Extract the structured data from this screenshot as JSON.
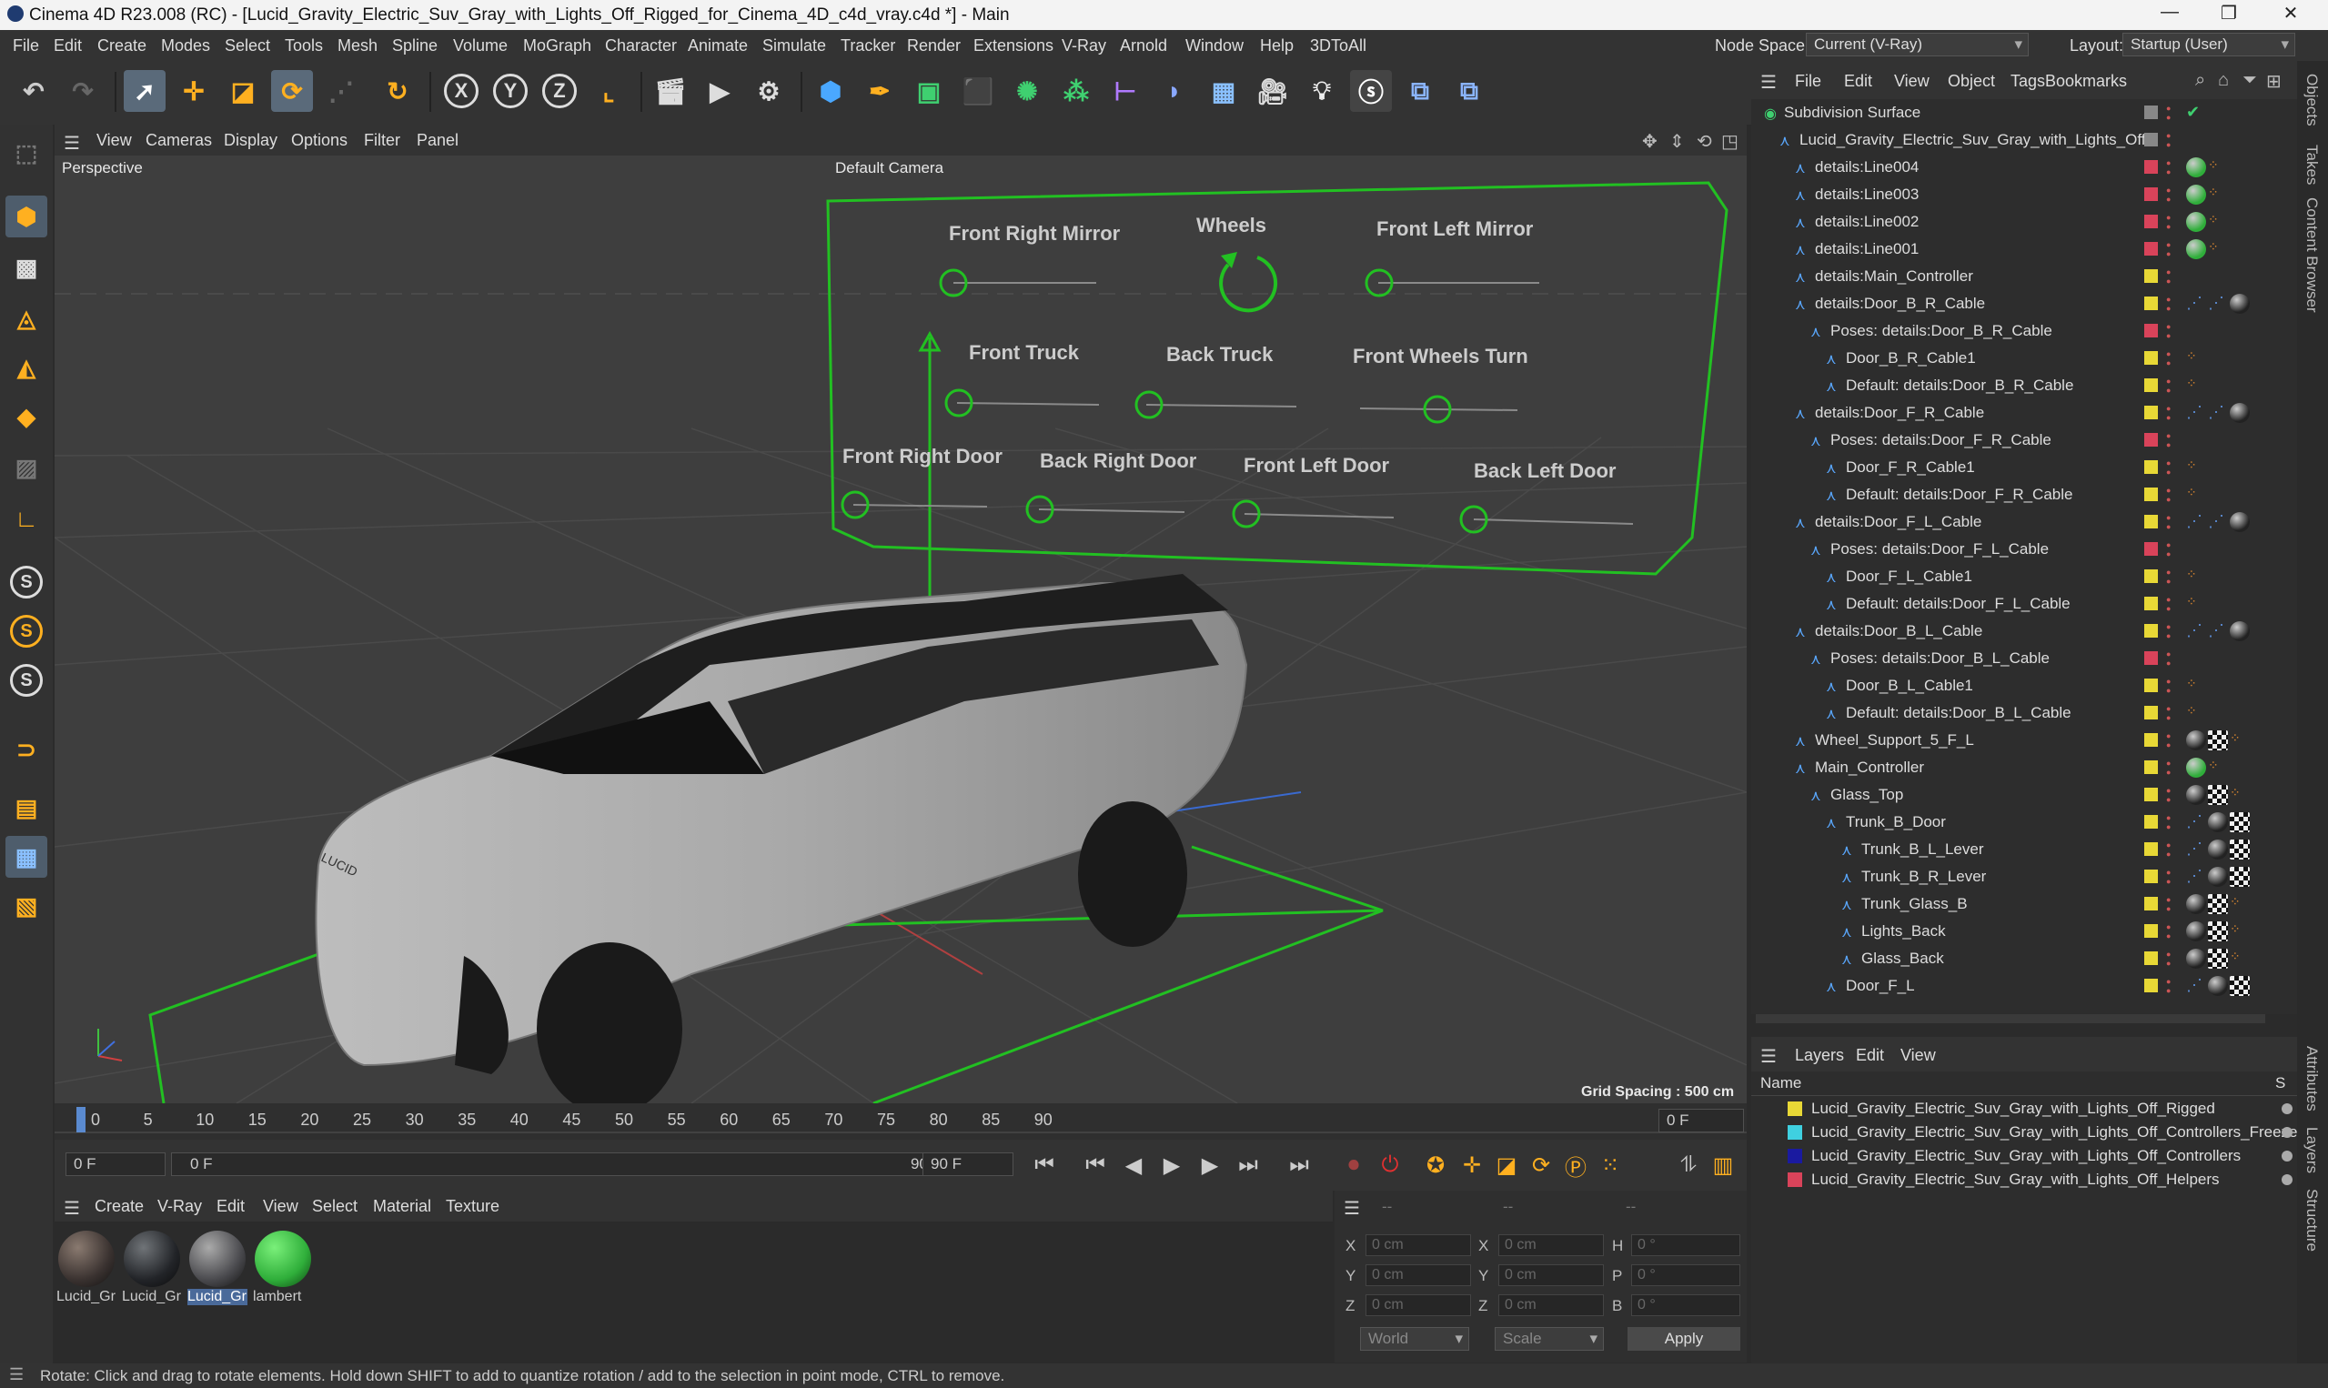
{
  "window": {
    "title": "Cinema 4D R23.008 (RC) - [Lucid_Gravity_Electric_Suv_Gray_with_Lights_Off_Rigged_for_Cinema_4D_c4d_vray.c4d *] - Main",
    "minimize": "—",
    "maximize": "❐",
    "close": "✕"
  },
  "menubar": {
    "items": [
      "File",
      "Edit",
      "Create",
      "Modes",
      "Select",
      "Tools",
      "Mesh",
      "Spline",
      "Volume",
      "MoGraph",
      "Character",
      "Animate",
      "Simulate",
      "Tracker",
      "Render",
      "Extensions",
      "V-Ray",
      "Arnold",
      "Window",
      "Help",
      "3DToAll"
    ],
    "node_space_label": "Node Space:",
    "node_space_value": "Current (V-Ray)",
    "layout_label": "Layout:",
    "layout_value": "Startup (User)"
  },
  "toolbar": {
    "axis_x": "X",
    "axis_y": "Y",
    "axis_z": "Z"
  },
  "lefttools": {
    "s1": "S",
    "s2": "S",
    "s3": "S"
  },
  "viewport": {
    "menu": [
      "View",
      "Cameras",
      "Display",
      "Options",
      "Filter",
      "Panel"
    ],
    "projection": "Perspective",
    "camera": "Default Camera",
    "grid_spacing": "Grid Spacing : 500 cm",
    "car_badge": "LUCID",
    "controls": {
      "front_right_mirror": "Front Right Mirror",
      "wheels": "Wheels",
      "front_left_mirror": "Front Left Mirror",
      "front_truck": "Front Truck",
      "back_truck": "Back Truck",
      "front_wheels_turn": "Front Wheels Turn",
      "front_right_door": "Front Right Door",
      "back_right_door": "Back Right Door",
      "front_left_door": "Front Left Door",
      "back_left_door": "Back Left Door"
    }
  },
  "timeline": {
    "ticks": [
      "0",
      "5",
      "10",
      "15",
      "20",
      "25",
      "30",
      "35",
      "40",
      "45",
      "50",
      "55",
      "60",
      "65",
      "70",
      "75",
      "80",
      "85",
      "90"
    ],
    "current_frame": "0 F",
    "start_frame": "0 F",
    "range_start": "0 F",
    "range_end": "90 F",
    "end_frame": "90 F"
  },
  "materials": {
    "menu": [
      "Create",
      "V-Ray",
      "Edit",
      "View",
      "Select",
      "Material",
      "Texture"
    ],
    "items": [
      {
        "label": "Lucid_Gr",
        "color": "#3a3230"
      },
      {
        "label": "Lucid_Gr",
        "color": "#222428"
      },
      {
        "label": "Lucid_Gr",
        "color": "#4a4a4e"
      },
      {
        "label": "lambert",
        "color": "#2fae3a"
      }
    ]
  },
  "coords": {
    "header_a": "--",
    "header_b": "--",
    "header_c": "--",
    "x": "X",
    "y": "Y",
    "z": "Z",
    "x2": "X",
    "y2": "Y",
    "z2": "Z",
    "h": "H",
    "p": "P",
    "b": "B",
    "zero_cm": "0 cm",
    "zero_deg": "0 °",
    "world": "World",
    "scale": "Scale",
    "apply": "Apply"
  },
  "status": "Rotate: Click and drag to rotate elements. Hold down SHIFT to add to quantize rotation / add to the selection in point mode, CTRL to remove.",
  "object_manager": {
    "menu": [
      "File",
      "Edit",
      "View",
      "Object",
      "Tags",
      "Bookmarks"
    ],
    "rows": [
      {
        "name": "Subdivision Surface",
        "indent": 0,
        "layer": "#888",
        "tags": [
          "check"
        ]
      },
      {
        "name": "Lucid_Gravity_Electric_Suv_Gray_with_Lights_Off",
        "indent": 1,
        "layer": "#888",
        "tags": []
      },
      {
        "name": "details:Line004",
        "indent": 2,
        "layer": "#d9435a",
        "tags": [
          "green",
          "orange"
        ]
      },
      {
        "name": "details:Line003",
        "indent": 2,
        "layer": "#d9435a",
        "tags": [
          "green",
          "orange"
        ]
      },
      {
        "name": "details:Line002",
        "indent": 2,
        "layer": "#d9435a",
        "tags": [
          "green",
          "orange"
        ]
      },
      {
        "name": "details:Line001",
        "indent": 2,
        "layer": "#d9435a",
        "tags": [
          "green",
          "orange"
        ]
      },
      {
        "name": "details:Main_Controller",
        "indent": 2,
        "layer": "#e8d836",
        "tags": []
      },
      {
        "name": "details:Door_B_R_Cable",
        "indent": 2,
        "layer": "#e8d836",
        "tags": [
          "blue",
          "blue",
          "dark"
        ]
      },
      {
        "name": "Poses: details:Door_B_R_Cable",
        "indent": 3,
        "layer": "#d9435a",
        "tags": []
      },
      {
        "name": "Door_B_R_Cable1",
        "indent": 4,
        "layer": "#e8d836",
        "tags": [
          "orange"
        ]
      },
      {
        "name": "Default: details:Door_B_R_Cable",
        "indent": 4,
        "layer": "#e8d836",
        "tags": [
          "orange"
        ]
      },
      {
        "name": "details:Door_F_R_Cable",
        "indent": 2,
        "layer": "#e8d836",
        "tags": [
          "blue",
          "blue",
          "dark"
        ]
      },
      {
        "name": "Poses: details:Door_F_R_Cable",
        "indent": 3,
        "layer": "#d9435a",
        "tags": []
      },
      {
        "name": "Door_F_R_Cable1",
        "indent": 4,
        "layer": "#e8d836",
        "tags": [
          "orange"
        ]
      },
      {
        "name": "Default: details:Door_F_R_Cable",
        "indent": 4,
        "layer": "#e8d836",
        "tags": [
          "orange"
        ]
      },
      {
        "name": "details:Door_F_L_Cable",
        "indent": 2,
        "layer": "#e8d836",
        "tags": [
          "blue",
          "blue",
          "dark"
        ]
      },
      {
        "name": "Poses: details:Door_F_L_Cable",
        "indent": 3,
        "layer": "#d9435a",
        "tags": []
      },
      {
        "name": "Door_F_L_Cable1",
        "indent": 4,
        "layer": "#e8d836",
        "tags": [
          "orange"
        ]
      },
      {
        "name": "Default: details:Door_F_L_Cable",
        "indent": 4,
        "layer": "#e8d836",
        "tags": [
          "orange"
        ]
      },
      {
        "name": "details:Door_B_L_Cable",
        "indent": 2,
        "layer": "#e8d836",
        "tags": [
          "blue",
          "blue",
          "dark"
        ]
      },
      {
        "name": "Poses: details:Door_B_L_Cable",
        "indent": 3,
        "layer": "#d9435a",
        "tags": []
      },
      {
        "name": "Door_B_L_Cable1",
        "indent": 4,
        "layer": "#e8d836",
        "tags": [
          "orange"
        ]
      },
      {
        "name": "Default: details:Door_B_L_Cable",
        "indent": 4,
        "layer": "#e8d836",
        "tags": [
          "orange"
        ]
      },
      {
        "name": "Wheel_Support_5_F_L",
        "indent": 2,
        "layer": "#e8d836",
        "tags": [
          "dark",
          "checker",
          "orange"
        ]
      },
      {
        "name": "Main_Controller",
        "indent": 2,
        "layer": "#e8d836",
        "tags": [
          "green",
          "orange"
        ]
      },
      {
        "name": "Glass_Top",
        "indent": 3,
        "layer": "#e8d836",
        "tags": [
          "dark",
          "checker",
          "orange"
        ]
      },
      {
        "name": "Trunk_B_Door",
        "indent": 4,
        "layer": "#e8d836",
        "tags": [
          "blue",
          "dark",
          "checker"
        ]
      },
      {
        "name": "Trunk_B_L_Lever",
        "indent": 5,
        "layer": "#e8d836",
        "tags": [
          "blue",
          "dark",
          "checker"
        ]
      },
      {
        "name": "Trunk_B_R_Lever",
        "indent": 5,
        "layer": "#e8d836",
        "tags": [
          "blue",
          "dark",
          "checker"
        ]
      },
      {
        "name": "Trunk_Glass_B",
        "indent": 5,
        "layer": "#e8d836",
        "tags": [
          "dark",
          "checker",
          "orange"
        ]
      },
      {
        "name": "Lights_Back",
        "indent": 5,
        "layer": "#e8d836",
        "tags": [
          "dark",
          "checker",
          "orange"
        ]
      },
      {
        "name": "Glass_Back",
        "indent": 5,
        "layer": "#e8d836",
        "tags": [
          "dark",
          "checker",
          "orange"
        ]
      },
      {
        "name": "Door_F_L",
        "indent": 4,
        "layer": "#e8d836",
        "tags": [
          "blue",
          "dark",
          "checker"
        ]
      }
    ]
  },
  "layers_manager": {
    "menu": [
      "Layers",
      "Edit",
      "View"
    ],
    "col_name": "Name",
    "col_s": "S",
    "rows": [
      {
        "name": "Lucid_Gravity_Electric_Suv_Gray_with_Lights_Off_Rigged",
        "color": "#e8d836"
      },
      {
        "name": "Lucid_Gravity_Electric_Suv_Gray_with_Lights_Off_Controllers_Freeze",
        "color": "#3fd0e0"
      },
      {
        "name": "Lucid_Gravity_Electric_Suv_Gray_with_Lights_Off_Controllers",
        "color": "#1a1aa0"
      },
      {
        "name": "Lucid_Gravity_Electric_Suv_Gray_with_Lights_Off_Helpers",
        "color": "#d9435a"
      }
    ]
  },
  "right_tabs": [
    "Objects",
    "Takes",
    "Content Browser",
    "Attributes",
    "Layers",
    "Structure"
  ]
}
